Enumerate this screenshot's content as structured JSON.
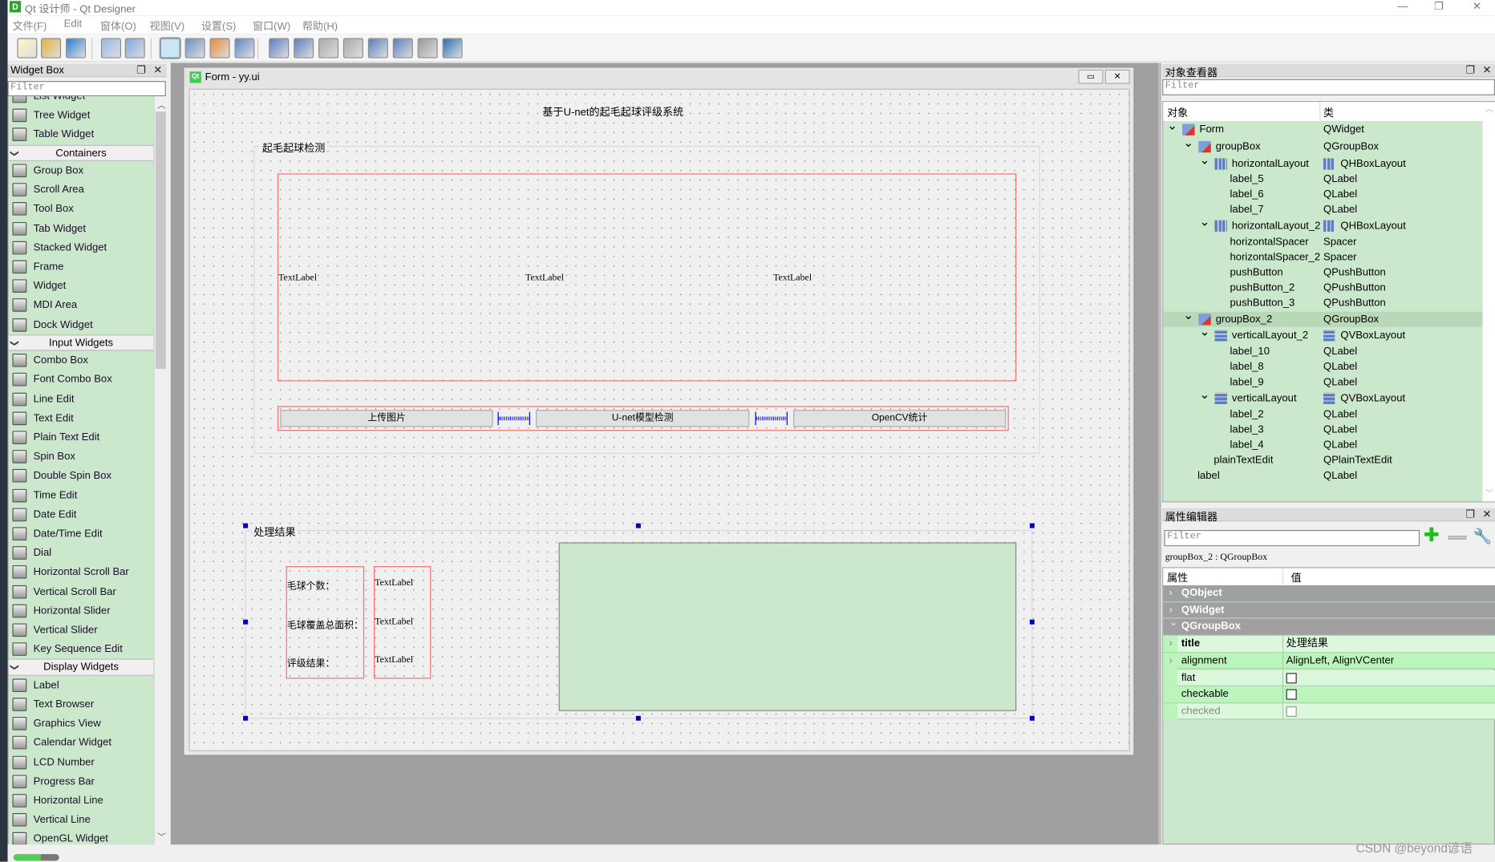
{
  "app": {
    "title": "Qt 设计师 - Qt Designer",
    "icon": "D"
  },
  "menu": [
    "文件(F)",
    "Edit",
    "窗体(O)",
    "视图(V)",
    "设置(S)",
    "窗口(W)",
    "帮助(H)"
  ],
  "toolbar": [
    "new-icon",
    "open-icon",
    "save-icon",
    "send-to-back-icon",
    "bring-to-front-icon",
    "edit-widgets-icon",
    "edit-signals-slots-icon",
    "edit-buddies-icon",
    "edit-tab-order-icon",
    "layout-horizontal-icon",
    "layout-vertical-icon",
    "layout-horizontal-splitter-icon",
    "layout-vertical-splitter-icon",
    "layout-grid-icon",
    "layout-form-icon",
    "break-layout-icon",
    "adjust-size-icon"
  ],
  "widget_box": {
    "title": "Widget Box",
    "filter_placeholder": "Filter",
    "groups": [
      {
        "header": null,
        "items": [
          "List Widget",
          "Tree Widget",
          "Table Widget"
        ]
      },
      {
        "header": "Containers",
        "items": [
          "Group Box",
          "Scroll Area",
          "Tool Box",
          "Tab Widget",
          "Stacked Widget",
          "Frame",
          "Widget",
          "MDI Area",
          "Dock Widget"
        ]
      },
      {
        "header": "Input Widgets",
        "items": [
          "Combo Box",
          "Font Combo Box",
          "Line Edit",
          "Text Edit",
          "Plain Text Edit",
          "Spin Box",
          "Double Spin Box",
          "Time Edit",
          "Date Edit",
          "Date/Time Edit",
          "Dial",
          "Horizontal Scroll Bar",
          "Vertical Scroll Bar",
          "Horizontal Slider",
          "Vertical Slider",
          "Key Sequence Edit"
        ]
      },
      {
        "header": "Display Widgets",
        "items": [
          "Label",
          "Text Browser",
          "Graphics View",
          "Calendar Widget",
          "LCD Number",
          "Progress Bar",
          "Horizontal Line",
          "Vertical Line",
          "OpenGL Widget"
        ]
      }
    ]
  },
  "form": {
    "window_title": "Form - yy.ui",
    "icon": "Qt",
    "title_label": "基于U-net的起毛起球评级系统",
    "groupBox": {
      "title": "起毛起球检测",
      "labels": [
        "TextLabel",
        "TextLabel",
        "TextLabel"
      ],
      "buttons": [
        "上传图片",
        "U-net模型检测",
        "OpenCV统计"
      ]
    },
    "groupBox_2": {
      "title": "处理结果",
      "left_labels": [
        "毛球个数：",
        "毛球覆盖总面积：",
        "评级结果："
      ],
      "right_labels": [
        "TextLabel",
        "TextLabel",
        "TextLabel"
      ]
    }
  },
  "object_inspector": {
    "title": "对象查看器",
    "filter_placeholder": "Filter",
    "col_object": "对象",
    "col_class": "类",
    "rows": [
      {
        "name": "Form",
        "cls": "QWidget",
        "level": 0,
        "exp": true,
        "icon": "widget"
      },
      {
        "name": "groupBox",
        "cls": "QGroupBox",
        "level": 1,
        "exp": true,
        "icon": "widget"
      },
      {
        "name": "horizontalLayout",
        "cls": "QHBoxLayout",
        "level": 2,
        "exp": true,
        "icon": "hbox"
      },
      {
        "name": "label_5",
        "cls": "QLabel",
        "level": 3
      },
      {
        "name": "label_6",
        "cls": "QLabel",
        "level": 3
      },
      {
        "name": "label_7",
        "cls": "QLabel",
        "level": 3
      },
      {
        "name": "horizontalLayout_2",
        "cls": "QHBoxLayout",
        "level": 2,
        "exp": true,
        "icon": "hbox"
      },
      {
        "name": "horizontalSpacer",
        "cls": "Spacer",
        "level": 3
      },
      {
        "name": "horizontalSpacer_2",
        "cls": "Spacer",
        "level": 3
      },
      {
        "name": "pushButton",
        "cls": "QPushButton",
        "level": 3
      },
      {
        "name": "pushButton_2",
        "cls": "QPushButton",
        "level": 3
      },
      {
        "name": "pushButton_3",
        "cls": "QPushButton",
        "level": 3
      },
      {
        "name": "groupBox_2",
        "cls": "QGroupBox",
        "level": 1,
        "exp": true,
        "icon": "widget",
        "selected": true
      },
      {
        "name": "verticalLayout_2",
        "cls": "QVBoxLayout",
        "level": 2,
        "exp": true,
        "icon": "vbox"
      },
      {
        "name": "label_10",
        "cls": "QLabel",
        "level": 3
      },
      {
        "name": "label_8",
        "cls": "QLabel",
        "level": 3
      },
      {
        "name": "label_9",
        "cls": "QLabel",
        "level": 3
      },
      {
        "name": "verticalLayout",
        "cls": "QVBoxLayout",
        "level": 2,
        "exp": true,
        "icon": "vbox"
      },
      {
        "name": "label_2",
        "cls": "QLabel",
        "level": 3
      },
      {
        "name": "label_3",
        "cls": "QLabel",
        "level": 3
      },
      {
        "name": "label_4",
        "cls": "QLabel",
        "level": 3
      },
      {
        "name": "plainTextEdit",
        "cls": "QPlainTextEdit",
        "level": 2
      },
      {
        "name": "label",
        "cls": "QLabel",
        "level": 1
      }
    ]
  },
  "property_editor": {
    "title": "属性编辑器",
    "filter_placeholder": "Filter",
    "object_info": "groupBox_2 : QGroupBox",
    "col_property": "属性",
    "col_value": "值",
    "sections": [
      "QObject",
      "QWidget",
      "QGroupBox"
    ],
    "rows": [
      {
        "name": "title",
        "value": "处理结果",
        "bold": true,
        "expandable": true
      },
      {
        "name": "alignment",
        "value": "AlignLeft, AlignVCenter",
        "expandable": true
      },
      {
        "name": "flat",
        "checkbox": true,
        "checked": false
      },
      {
        "name": "checkable",
        "checkbox": true,
        "checked": false
      },
      {
        "name": "checked",
        "checkbox": true,
        "checked": false,
        "disabled": true
      }
    ]
  },
  "watermark": "CSDN @beyond谚语",
  "colors": {
    "designer_green": "#cce8cc",
    "layout_red": "#f07070",
    "selection_blue": "#0000c0",
    "section_gray": "#a0a0a0"
  }
}
